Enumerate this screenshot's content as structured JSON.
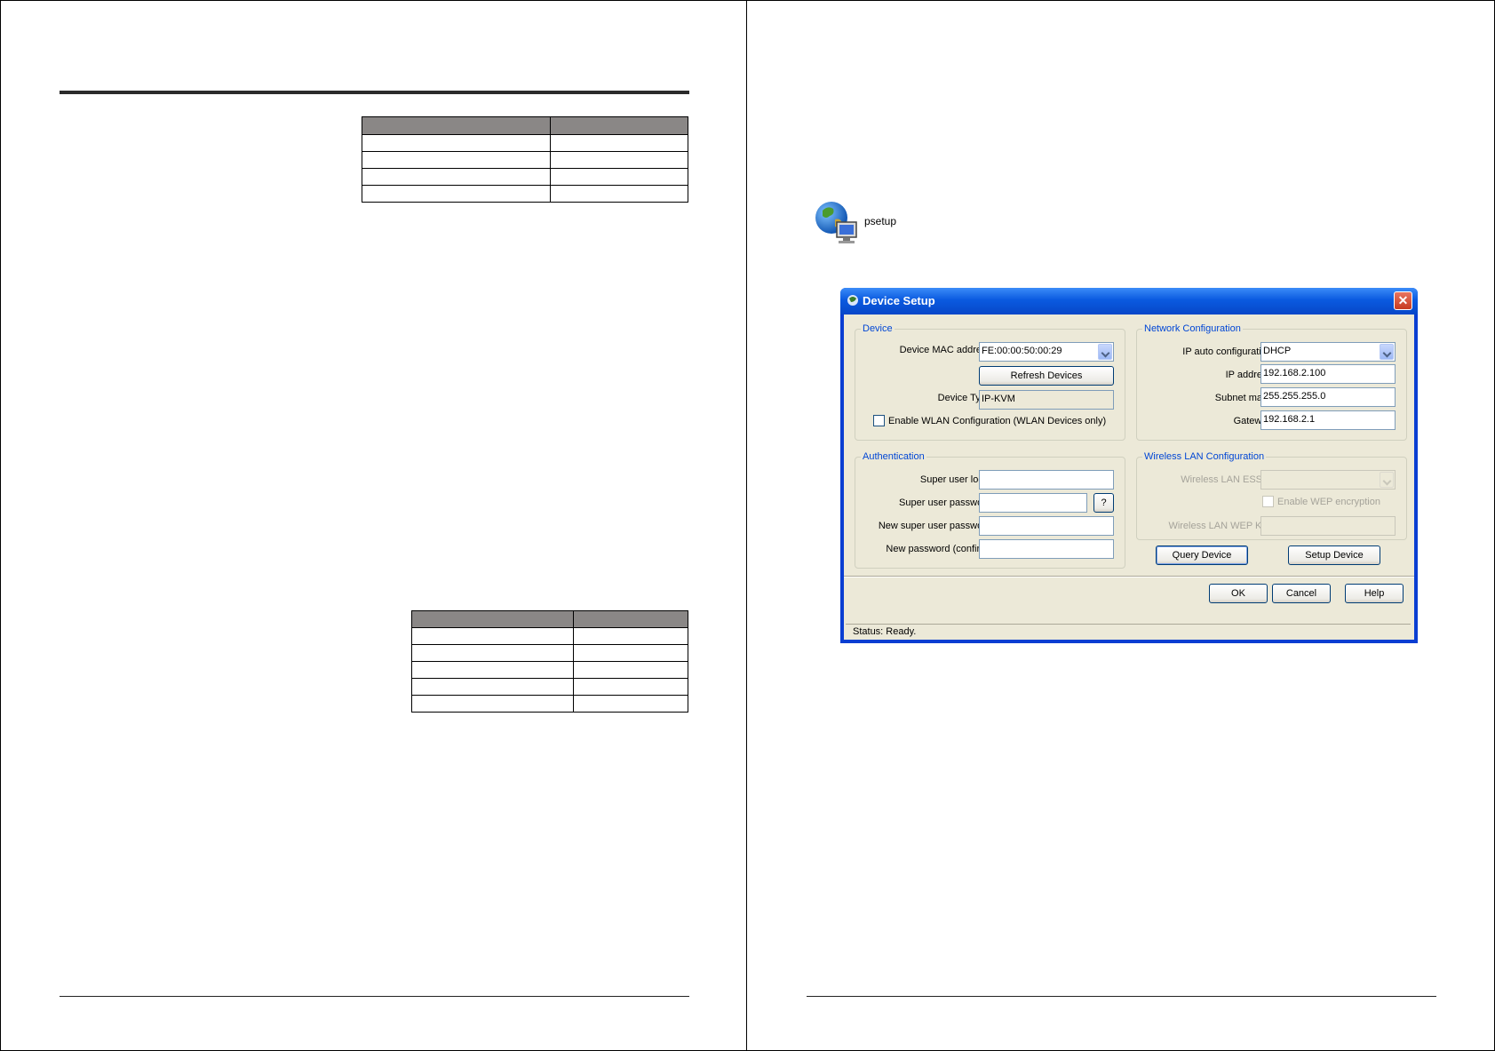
{
  "desktop_icon": {
    "label": "psetup"
  },
  "window": {
    "title": "Device Setup",
    "device_group": {
      "legend": "Device",
      "mac_label": "Device MAC address",
      "mac_value": "FE:00:00:50:00:29",
      "refresh_button": "Refresh Devices",
      "type_label": "Device Type",
      "type_value": "IP-KVM",
      "wlan_checkbox": "Enable WLAN Configuration (WLAN Devices only)"
    },
    "network_group": {
      "legend": "Network Configuration",
      "auto_label": "IP auto configuration",
      "auto_value": "DHCP",
      "ip_label": "IP address",
      "ip_value": "192.168.2.100",
      "mask_label": "Subnet mask",
      "mask_value": "255.255.255.0",
      "gw_label": "Gateway",
      "gw_value": "192.168.2.1"
    },
    "auth_group": {
      "legend": "Authentication",
      "login_label": "Super user login",
      "pwd_label": "Super user password",
      "help_button": "?",
      "new_pwd_label": "New super user password",
      "confirm_label": "New password (confirm)"
    },
    "wireless_group": {
      "legend": "Wireless LAN Configuration",
      "essid_label": "Wireless LAN ESSID",
      "wep_checkbox": "Enable WEP encryption",
      "wep_key_label": "Wireless LAN WEP Key"
    },
    "query_button": "Query Device",
    "setup_button": "Setup Device",
    "ok_button": "OK",
    "cancel_button": "Cancel",
    "help_button": "Help",
    "status": "Status:  Ready."
  },
  "colors": {
    "title_bar": "#0a5ae0",
    "dialog_bg": "#ece9d8",
    "group_legend": "#0046d5",
    "table_header": "#8a8786"
  }
}
